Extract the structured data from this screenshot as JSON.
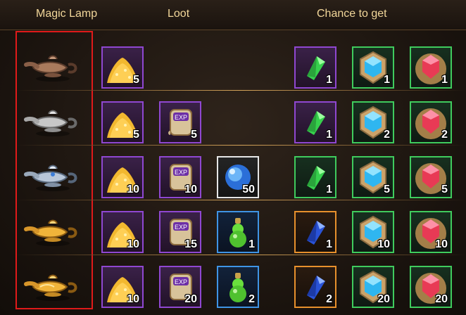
{
  "header": {
    "col1": "Magic Lamp",
    "col2": "Loot",
    "col3": "Chance to get"
  },
  "rows": [
    {
      "lamp": "bronze",
      "loot": [
        {
          "type": "gold",
          "qty": "5"
        }
      ],
      "chance": [
        {
          "type": "green-crystal",
          "qty": "1"
        },
        {
          "type": "blue-gem",
          "qty": "1"
        },
        {
          "type": "red-gem",
          "qty": "1"
        }
      ]
    },
    {
      "lamp": "silver",
      "loot": [
        {
          "type": "gold",
          "qty": "5"
        },
        {
          "type": "exp-scroll",
          "qty": "5"
        }
      ],
      "chance": [
        {
          "type": "green-crystal",
          "qty": "1"
        },
        {
          "type": "blue-gem",
          "qty": "2"
        },
        {
          "type": "red-gem",
          "qty": "2"
        }
      ]
    },
    {
      "lamp": "silver-blue",
      "loot": [
        {
          "type": "gold",
          "qty": "10"
        },
        {
          "type": "exp-scroll",
          "qty": "10"
        },
        {
          "type": "blue-sphere",
          "qty": "50"
        }
      ],
      "chance": [
        {
          "type": "green-crystal",
          "qty": "1"
        },
        {
          "type": "blue-gem",
          "qty": "5"
        },
        {
          "type": "red-gem",
          "qty": "5"
        }
      ]
    },
    {
      "lamp": "gold",
      "loot": [
        {
          "type": "gold",
          "qty": "10"
        },
        {
          "type": "exp-scroll",
          "qty": "15"
        },
        {
          "type": "green-potion",
          "qty": "1"
        }
      ],
      "chance": [
        {
          "type": "blue-crystal",
          "qty": "1"
        },
        {
          "type": "blue-gem",
          "qty": "10"
        },
        {
          "type": "red-gem",
          "qty": "10"
        }
      ]
    },
    {
      "lamp": "ornate-gold",
      "loot": [
        {
          "type": "gold",
          "qty": "10"
        },
        {
          "type": "exp-scroll",
          "qty": "20"
        },
        {
          "type": "green-potion",
          "qty": "2"
        }
      ],
      "chance": [
        {
          "type": "blue-crystal",
          "qty": "2"
        },
        {
          "type": "blue-gem",
          "qty": "20"
        },
        {
          "type": "red-gem",
          "qty": "20"
        }
      ]
    }
  ],
  "colors": {
    "red-border": "#e01a1a",
    "purple": "#8f47d1",
    "green": "#3fcb5d",
    "orange": "#e7902c",
    "blue": "#3f94e5"
  }
}
